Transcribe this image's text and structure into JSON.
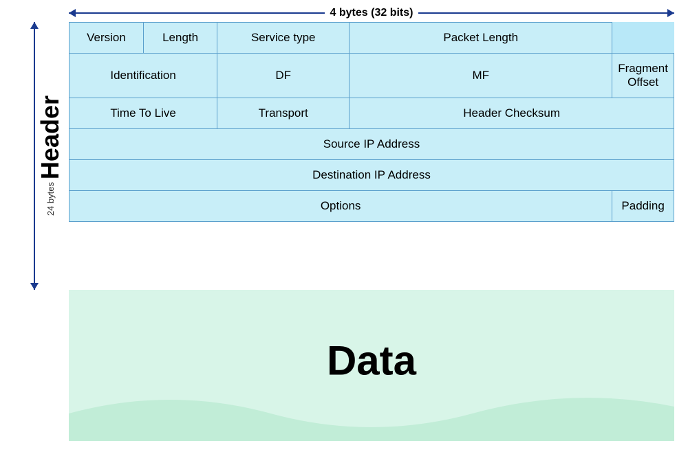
{
  "top_label": "4 bytes (32 bits)",
  "left_labels": {
    "header": "Header",
    "bytes": "24 bytes"
  },
  "table": {
    "rows": [
      {
        "cells": [
          {
            "label": "Version",
            "colspan": 1,
            "rowspan": 1
          },
          {
            "label": "Length",
            "colspan": 1,
            "rowspan": 1
          },
          {
            "label": "Service type",
            "colspan": 1,
            "rowspan": 1
          },
          {
            "label": "Packet Length",
            "colspan": 1,
            "rowspan": 1
          }
        ]
      },
      {
        "cells": [
          {
            "label": "Identification",
            "colspan": 1,
            "rowspan": 1
          },
          {
            "label": "DF",
            "colspan": 1,
            "rowspan": 1
          },
          {
            "label": "MF",
            "colspan": 1,
            "rowspan": 1
          },
          {
            "label": "Fragment Offset",
            "colspan": 1,
            "rowspan": 1
          }
        ]
      },
      {
        "cells": [
          {
            "label": "Time To Live",
            "colspan": 1,
            "rowspan": 1
          },
          {
            "label": "Transport",
            "colspan": 1,
            "rowspan": 1
          },
          {
            "label": "Header Checksum",
            "colspan": 1,
            "rowspan": 1
          }
        ]
      },
      {
        "cells": [
          {
            "label": "Source IP Address",
            "colspan": 1,
            "rowspan": 1
          }
        ]
      },
      {
        "cells": [
          {
            "label": "Destination IP Address",
            "colspan": 1,
            "rowspan": 1
          }
        ]
      },
      {
        "cells": [
          {
            "label": "Options",
            "colspan": 1,
            "rowspan": 1
          },
          {
            "label": "Padding",
            "colspan": 1,
            "rowspan": 1
          }
        ]
      }
    ],
    "data_label": "Data"
  },
  "colors": {
    "arrow": "#1a3a8f",
    "table_bg": "#c8eef8",
    "table_border": "#5a9fcc",
    "data_bg": "#d8f5e8"
  }
}
